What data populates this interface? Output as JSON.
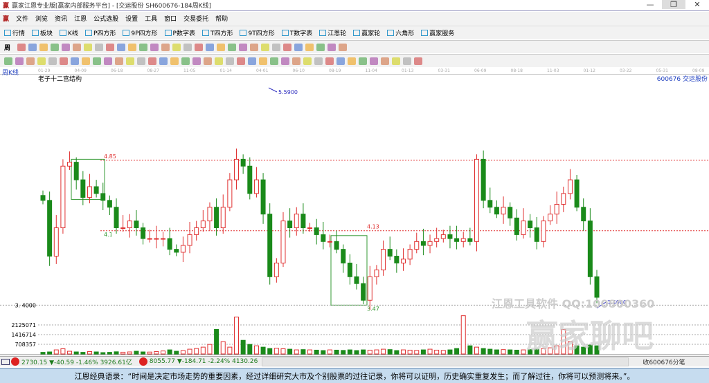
{
  "window": {
    "title": "赢家江恩专业版[赢家内部服务平台] - [交运股份  SH600676-184周K线]",
    "min": "—",
    "max": "❐",
    "close": "✕"
  },
  "menu": [
    "文件",
    "浏览",
    "资讯",
    "江恩",
    "公式选股",
    "设置",
    "工具",
    "窗口",
    "交易委托",
    "帮助"
  ],
  "toolbar": [
    "行情",
    "板块",
    "K线",
    "P四方形",
    "9P四方形",
    "P数字表",
    "T四方形",
    "9T四方形",
    "T数字表",
    "江恩轮",
    "赢家轮",
    "六角形",
    "赢家服务"
  ],
  "period_select": "周",
  "chart_header": {
    "period": "周K线",
    "indicator": "老子十二宫结构",
    "code": "600676",
    "name": "交运股份"
  },
  "date_ticks": [
    "01-29",
    "04-09",
    "06-18",
    "08-27",
    "11-05",
    "01-14",
    "04-01",
    "06-10",
    "08-19",
    "11-04",
    "01-13",
    "03-31",
    "06-09",
    "08-18",
    "11-03",
    "01-12",
    "03-22",
    "05-31",
    "08-09"
  ],
  "colors": {
    "up": "#e03030",
    "down": "#1a8a1a",
    "marker": "#3030c0"
  },
  "chart_data": {
    "type": "candlestick",
    "price_range": [
      3.37,
      5.59
    ],
    "annotations": {
      "high": "5.5900",
      "low": "3.4000",
      "level_red1": "4.85",
      "level_red2": "4.13",
      "box_low": "3.47",
      "level_mid": "4.1",
      "axis_price": "3. 4000"
    },
    "closes": [
      4.44,
      3.87,
      4.16,
      4.79,
      4.83,
      4.65,
      4.47,
      4.58,
      4.51,
      4.44,
      4.37,
      4.16,
      4.16,
      4.23,
      4.16,
      4.05,
      4.05,
      4.05,
      4.05,
      3.94,
      3.91,
      3.98,
      4.09,
      4.16,
      4.23,
      4.37,
      4.16,
      4.37,
      4.65,
      4.86,
      4.79,
      4.51,
      4.65,
      4.3,
      3.66,
      3.8,
      4.23,
      4.16,
      4.3,
      4.16,
      4.16,
      4.09,
      4.02,
      4.02,
      3.94,
      3.8,
      3.66,
      3.59,
      3.42,
      3.66,
      3.73,
      3.94,
      3.87,
      3.8,
      3.84,
      3.94,
      4.02,
      3.98,
      4.02,
      4.05,
      4.09,
      4.05,
      4.02,
      4.05,
      4.02,
      4.86,
      4.44,
      4.37,
      4.3,
      4.37,
      4.26,
      4.09,
      4.23,
      4.16,
      4.02,
      4.23,
      4.3,
      4.4,
      4.51,
      4.65,
      4.37,
      4.23,
      3.66,
      3.45
    ],
    "volume_ticks": [
      "2125071",
      "1416714",
      "708357"
    ],
    "volumes": [
      120,
      150,
      300,
      380,
      200,
      150,
      120,
      180,
      150,
      100,
      120,
      160,
      130,
      150,
      200,
      150,
      140,
      180,
      220,
      300,
      200,
      250,
      350,
      400,
      500,
      700,
      1800,
      900,
      500,
      2700,
      1000,
      700,
      600,
      500,
      400,
      420,
      380,
      350,
      300,
      320,
      300,
      280,
      250,
      300,
      280,
      260,
      300,
      250,
      300,
      280,
      300,
      350,
      320,
      250,
      300,
      280,
      260,
      300,
      350,
      280,
      260,
      300,
      400,
      2800,
      600,
      500,
      400,
      350,
      300,
      320,
      300,
      280,
      300,
      320,
      350,
      400,
      450,
      600,
      1800,
      900,
      600,
      500,
      650,
      600
    ]
  },
  "status": {
    "sh": "2730.15 ▼-40.59 -1.46% 3926.61亿",
    "sz": "8055.77 ▼-184.71 -2.24% 4130.26",
    "right": "收600676分笔"
  },
  "watermark": {
    "line1": "江恩工具软件  QQ:100800360",
    "line2": "赢家聊吧"
  },
  "quote": "江恩经典语录：“时间是决定市场走势的重要因素，经过详细研究大市及个别股票的过往记录，你将可以证明，历史确实重复发生；而了解过往，你将可以预测将来。”。"
}
